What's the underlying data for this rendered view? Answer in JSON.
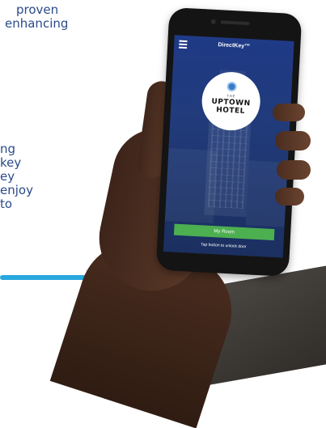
{
  "marketing_copy": {
    "top_lines": [
      "proven",
      "enhancing"
    ],
    "middle_lines": [
      "ng",
      "key",
      "ey",
      "enjoy",
      "to"
    ]
  },
  "phone_app": {
    "title": "DirectKey™",
    "hotel_logo": {
      "small_text": "THE",
      "line1": "UPTOWN",
      "line2": "HOTEL"
    },
    "primary_button_label": "My Room",
    "hint_text": "Tap button to unlock door"
  },
  "colors": {
    "accent_rule": "#29a8e0",
    "copy_text": "#2a4a8a",
    "screen_bg": "#1f3a86",
    "button_green": "#4caf50"
  }
}
